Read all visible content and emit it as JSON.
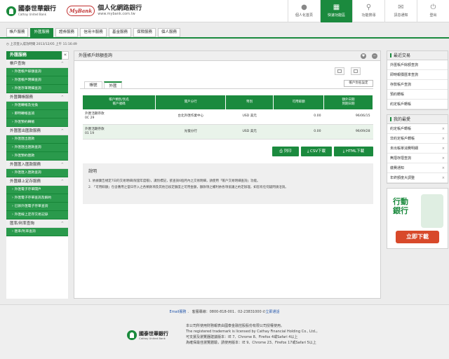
{
  "header": {
    "logo_name": "國泰世華銀行",
    "logo_sub": "Cathay United Bank",
    "mybank": "MyBank",
    "site_title": "個人化網路銀行",
    "site_url": "www.mybank.com.tw",
    "nav": [
      {
        "label": "個人化首頁",
        "icon": "person-icon"
      },
      {
        "label": "快速功能區",
        "icon": "quick-icon"
      },
      {
        "label": "功能搜尋",
        "icon": "search-icon"
      },
      {
        "label": "訊息通知",
        "icon": "mail-icon"
      },
      {
        "label": "登出",
        "icon": "logout-icon"
      }
    ]
  },
  "tabs": [
    "帳戶服務",
    "外匯服務",
    "證券服務",
    "信用卡服務",
    "基金服務",
    "保險服務",
    "個人服務"
  ],
  "login_info": "上次登入成功時間 2013/12/05 上午 11:16:49",
  "sidebar": {
    "title": "外匯服務",
    "collapse": "«",
    "sections": [
      {
        "label": "帳戶查詢",
        "caret": "^",
        "items": [
          "外匯帳戶餘額查詢",
          "外匯帳戶明細查詢",
          "外匯存單明細查詢"
        ]
      },
      {
        "label": "外匯轉帳服務",
        "caret": "^",
        "items": [
          "外匯轉帳及兌換",
          "即時轉帳查詢",
          "外匯預約轉帳"
        ]
      },
      {
        "label": "外匯匯出匯款服務",
        "caret": "^",
        "items": [
          "外匯匯出匯款",
          "外匯匯出匯款查詢",
          "外匯預約匯款"
        ]
      },
      {
        "label": "外匯匯入匯款服務",
        "caret": "^",
        "items": [
          "外匯匯入匯款查詢"
        ]
      },
      {
        "label": "外匯線上定存服務",
        "caret": "^",
        "items": [
          "外匯電子存單開戶",
          "外匯電子存單查詢及解約",
          "已辦外匯電子存單查詢",
          "外匯線上定存交易記錄"
        ]
      },
      {
        "label": "匯率/利率查詢",
        "caret": "^",
        "items": [
          "匯率/利率查詢"
        ]
      }
    ]
  },
  "main": {
    "title": "外匯帳戶餘額查詢",
    "subtabs": [
      "帳號",
      "外匯"
    ],
    "acct_settings": "帳戶別名設定",
    "columns": [
      "帳戶類別/別名\n帳戶號碼",
      "開戶分行",
      "幣別",
      "可用餘額",
      "額外日期\n到期日期"
    ],
    "rows": [
      {
        "type": "外匯活期存款",
        "acct": "0C             29",
        "branch": "台北外匯作業中心",
        "currency": "USD 美元",
        "balance": "0.00",
        "date": "96/06/15"
      },
      {
        "type": "外匯活期存款",
        "acct": "01             19",
        "branch": "光復分行",
        "currency": "USD 美元",
        "balance": "0.00",
        "date": "96/09/28"
      }
    ],
    "buttons": {
      "print": "列印",
      "csv": "CSV下載",
      "html": "HTML下載"
    },
    "notes_title": "說明",
    "notes": [
      "1. 依據廣告規定7日的交易明細(限當年度帳)，識別標記，欲查詢6個月內之交易明細，請使用「帳戶交易明細查詢」功能。",
      "2. 「可用餘額」包含應用之當日存入之各類款項及其他已核定額度之可用金額，額款項之權利依各項協議之約定辦理，如您有任何疑問請洽詢。"
    ]
  },
  "right": {
    "section1": "最近交易",
    "recent": [
      "外匯帳戶餘額查詢",
      "即時報價匯率查詢",
      "存款帳戶查詢",
      "預約轉帳",
      "約定帳戶轉帳"
    ],
    "section2": "我的最愛",
    "favorites": [
      "約定帳戶轉帳",
      "非約定帳戶轉帳",
      "未出帳單消費明細",
      "無摺存摺查詢",
      "繳費通知",
      "年終額度大調整"
    ],
    "ad_title": "行動\n銀行",
    "ad_button": "立即下載"
  },
  "footer": {
    "line1": "Email服務",
    "line1b": "客服專線：0800-818-001．02-23831000",
    "line1c": "立即通話",
    "logo_name": "國泰世華銀行",
    "logo_sub": "Cathay United Bank",
    "text": [
      "本公司所使用財務報表由國泰金融控股股份有限公司授權使用。",
      "The registered trademark is licensed by Cathay Financial Holding Co., Ltd.。",
      "可支援及瀏覽器建議版本：IE 7、Chrome 8、Firefox 4或Safari 4以上",
      "為確保最佳瀏覽體驗，請使用版本：IE 9、Chrome 23、Firefox 17或Safari 5以上"
    ]
  },
  "colors": {
    "brand_green": "#1b8a3e",
    "ad_red": "#d8492a"
  }
}
